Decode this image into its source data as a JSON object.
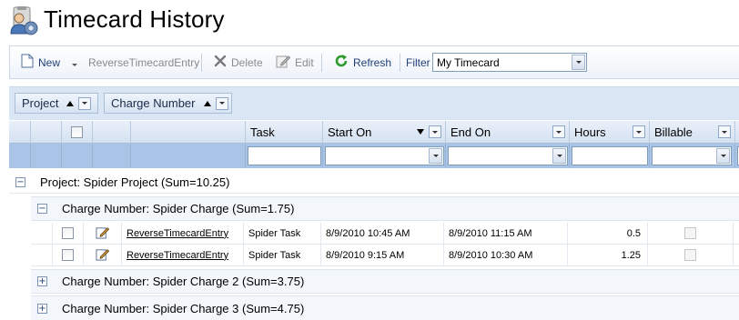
{
  "page": {
    "title": "Timecard History"
  },
  "toolbar": {
    "new_label": "New",
    "reverse_label": "ReverseTimecardEntry",
    "delete_label": "Delete",
    "edit_label": "Edit",
    "refresh_label": "Refresh",
    "filter_label": "Filter",
    "filter_value": "My Timecard"
  },
  "group_panel": {
    "chips": [
      {
        "label": "Project"
      },
      {
        "label": "Charge Number"
      }
    ]
  },
  "grid": {
    "columns": {
      "task": "Task",
      "start_on": "Start On",
      "end_on": "End On",
      "hours": "Hours",
      "billable": "Billable"
    },
    "project_group": "Project: Spider Project (Sum=10.25)",
    "charge_groups": [
      "Charge Number: Spider Charge (Sum=1.75)",
      "Charge Number: Spider Charge 2 (Sum=3.75)",
      "Charge Number: Spider Charge 3 (Sum=4.75)"
    ],
    "rows": [
      {
        "action": "ReverseTimecardEntry",
        "task": "Spider Task",
        "start_on": "8/9/2010 10:45 AM",
        "end_on": "8/9/2010 11:15 AM",
        "hours": "0.5"
      },
      {
        "action": "ReverseTimecardEntry",
        "task": "Spider Task",
        "start_on": "8/9/2010 9:15 AM",
        "end_on": "8/9/2010 10:30 AM",
        "hours": "1.25"
      }
    ]
  },
  "icons": {
    "title": "people-gear-icon",
    "new": "new-document-icon",
    "delete": "delete-x-icon",
    "edit": "edit-pencil-icon",
    "refresh": "refresh-arrow-icon",
    "row_edit": "edit-pencil-icon"
  },
  "colors": {
    "toolbar_text": "#1f3e7a",
    "header_bg": "#d4e1f1",
    "filter_row_bg": "#a9c4e6",
    "refresh_green": "#2e9a2e"
  }
}
